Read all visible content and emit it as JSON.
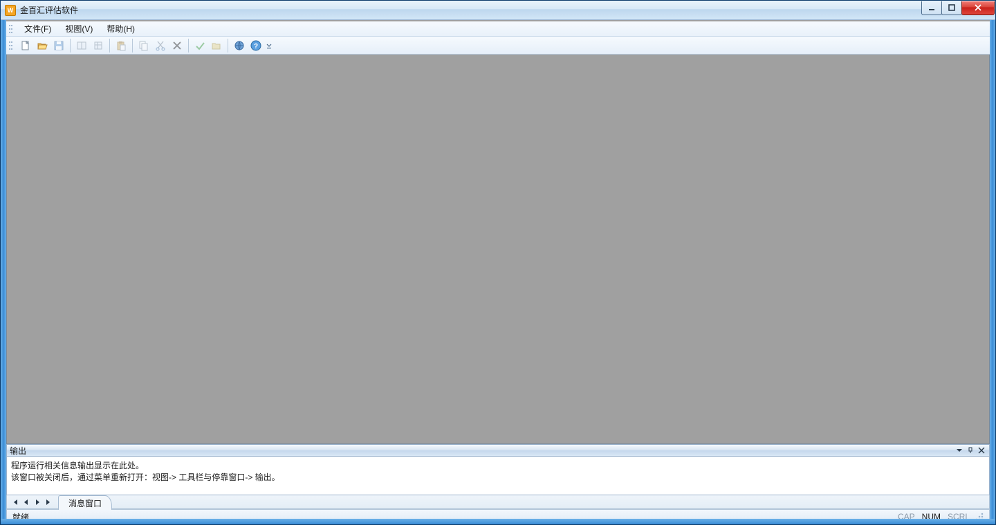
{
  "titlebar": {
    "app_title": "金百汇评估软件",
    "icon_text": "W"
  },
  "menubar": {
    "items": [
      {
        "label": "文件(F)"
      },
      {
        "label": "视图(V)"
      },
      {
        "label": "帮助(H)"
      }
    ]
  },
  "output_panel": {
    "title": "输出",
    "lines": [
      "程序运行相关信息输出显示在此处。",
      "该窗口被关闭后，通过菜单重新打开：视图-> 工具栏与停靠窗口-> 输出。"
    ],
    "tab_label": "消息窗口"
  },
  "statusbar": {
    "ready": "就绪",
    "cap": "CAP",
    "num": "NUM",
    "scrl": "SCRL"
  }
}
